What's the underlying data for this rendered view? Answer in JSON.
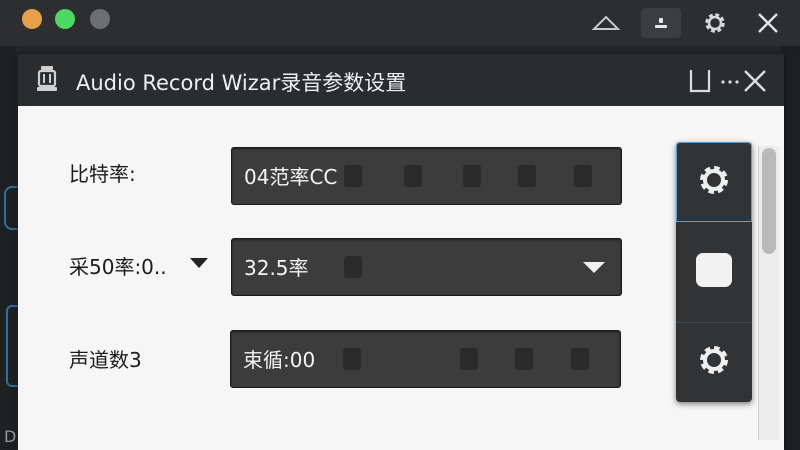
{
  "os_bar": {
    "icons": [
      "eject-icon",
      "user-icon",
      "gear-icon",
      "close-icon"
    ]
  },
  "dialog": {
    "title": "Audio Record Wizar录音参数设置",
    "icon": "microphone-icon",
    "controls": [
      "maximize-icon",
      "more-icon",
      "close-icon"
    ]
  },
  "fields": [
    {
      "label": "比特率:",
      "value": "04范率CC",
      "type": "text"
    },
    {
      "label": "采50率:0..",
      "value": "32.5率",
      "type": "dropdown"
    },
    {
      "label": "声道数3",
      "value": "束循:00",
      "type": "text"
    }
  ],
  "tool_panel": {
    "buttons": [
      "gear-icon",
      "stop-icon",
      "gear-icon"
    ]
  },
  "background": {
    "left_text": "D"
  },
  "colors": {
    "accent": "#5d9ccf",
    "field_bg": "#3c3c3d",
    "title_bg": "#2b2c2e"
  }
}
